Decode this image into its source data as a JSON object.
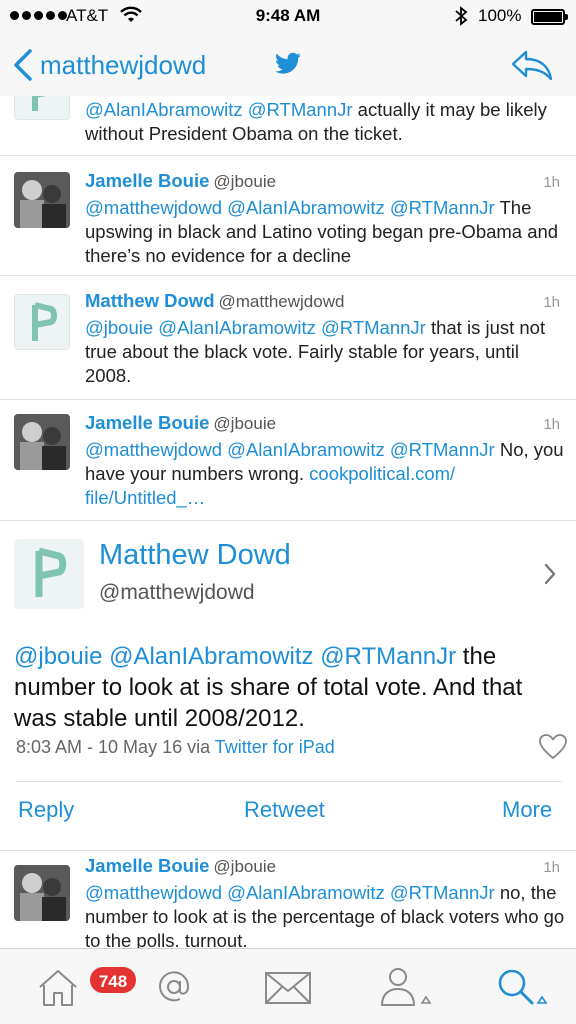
{
  "status_bar": {
    "carrier": "AT&T",
    "time": "9:48 AM",
    "battery": "100%"
  },
  "nav": {
    "back_label": "matthewjdowd"
  },
  "tweets": [
    {
      "body_mentions": "@AlanIAbramowitz @RTMannJr",
      "body_text": " actually it may be likely without President Obama on the ticket."
    },
    {
      "name": "Jamelle Bouie",
      "handle": "@jbouie",
      "ago": "1h",
      "body_mentions": "@matthewjdowd @AlanIAbramowitz @RTMannJr",
      "body_text": " The upswing in black and Latino voting began pre-Obama and there’s no evidence for a decline"
    },
    {
      "name": "Matthew Dowd",
      "handle": "@matthewjdowd",
      "ago": "1h",
      "body_mentions": "@jbouie @AlanIAbramowitz @RTMannJr",
      "body_text": " that is just not true about the black vote.  Fairly stable for years, until 2008."
    },
    {
      "name": "Jamelle Bouie",
      "handle": "@jbouie",
      "ago": "1h",
      "body_mentions": "@matthewjdowd @AlanIAbramowitz @RTMannJr",
      "body_text": " No, you have your numbers wrong. ",
      "link": "cookpolitical.com/ file/Untitled_…"
    }
  ],
  "expanded": {
    "name": "Matthew Dowd",
    "handle": "@matthewjdowd",
    "mentions": "@jbouie @AlanIAbramowitz @RTMannJr",
    "text": " the number to look at is share of total vote.  And that was stable until 2008/2012.",
    "timestamp": "8:03 AM - 10 May 16 via ",
    "via": "Twitter for iPad",
    "actions": {
      "reply": "Reply",
      "retweet": "Retweet",
      "more": "More"
    }
  },
  "reply_tweet": {
    "name": "Jamelle Bouie",
    "handle": "@jbouie",
    "ago": "1h",
    "body_mentions": "@matthewjdowd @AlanIAbramowitz @RTMannJr",
    "body_text": " no, the number to look at is the percentage of black voters who go to the polls. turnout."
  },
  "tab_bar": {
    "badge": "748",
    "icons": [
      "home-icon",
      "mentions-icon",
      "messages-icon",
      "profile-icon",
      "search-icon"
    ]
  },
  "colors": {
    "accent": "#1e8fd6",
    "badge": "#e53333"
  }
}
